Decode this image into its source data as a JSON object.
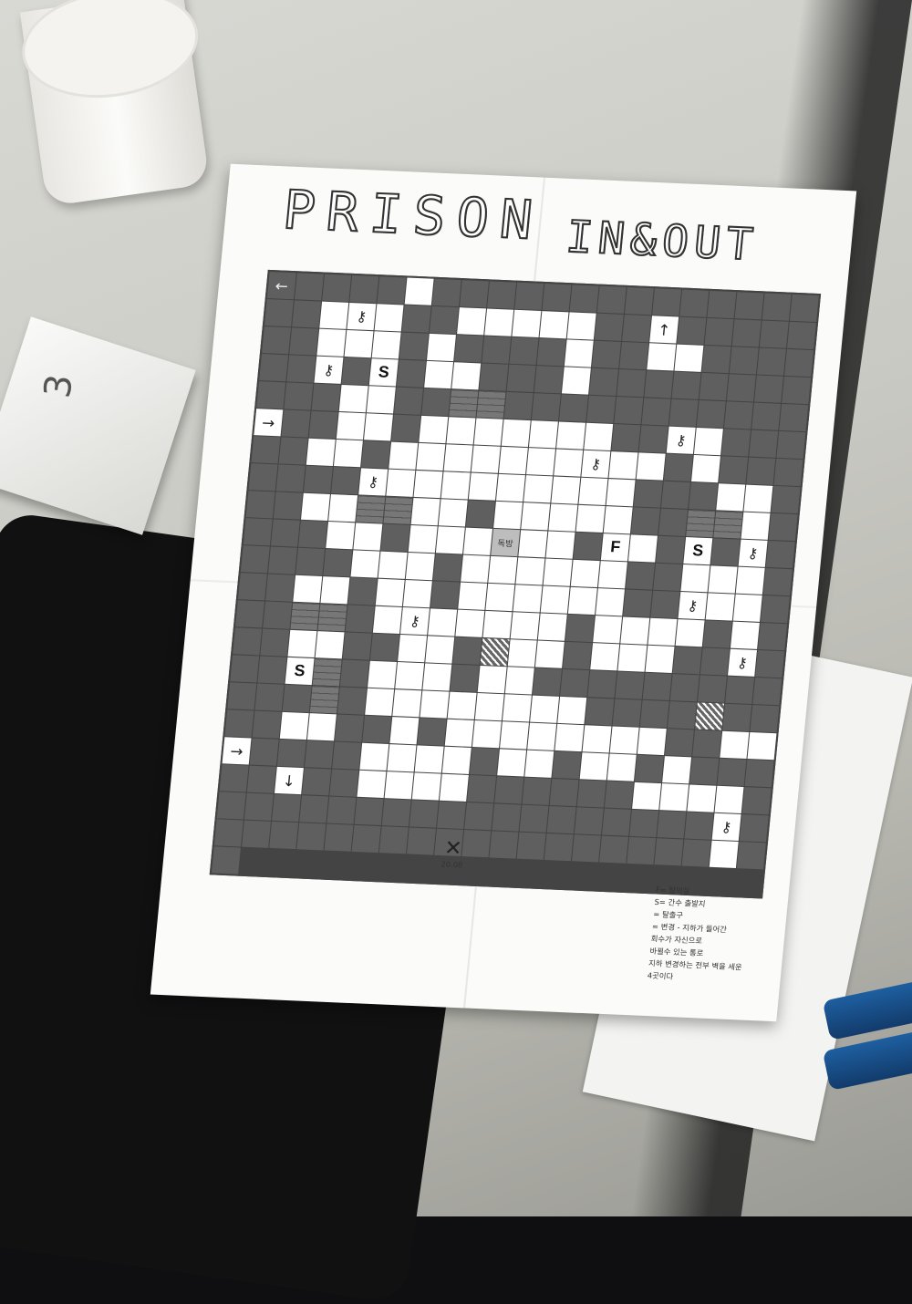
{
  "title": {
    "word1": "PRISON",
    "word2": "IN&OUT"
  },
  "board": {
    "start_label": "독방",
    "rows": [
      "<DDDDWDDDDDDDDDDDDDDD",
      "DWKWDDWWWWWDDUDDDDDD",
      "DWWWDWDDDDWDDWWDDDDD",
      "DKDSDWWDDDWDDDDDDDDD",
      "DDWWDDBBDDDDDDDDDDD>",
      "DDWWDWWWWWWWDDKWDDDD",
      "DWWDWWWWWWWKWWDWDDDD",
      "DDDKWWWWWWWWWDDDWWDD",
      "DWWBBWWDWWWWWDDBBWDD",
      "DDWWDWWWTWWDFWDSDKDD",
      "DDDWWWDWWWWWWDDWWWDD",
      "DWWDWWDWWWWWWDDKWWDD",
      "DBBDWKWWWWWDWWWWDWDD",
      "DWWDDWWDHWWDWWWDDKDD",
      "DSBDWWWDWWDDDDDDDDDD",
      "DDBDWWWWWWWWDDDDHDDD",
      "DWWDDWDWWWWWWWWDDWW>",
      "DDDDWWWWDWWDWWDWDDDD",
      "DvDDWWWWDDDDDDWWWWDD",
      "DDDDDDDDDDDDDDDDDKDD",
      "DDDDDDDDDDDDDDDDDWDD"
    ]
  },
  "legend": [
    "F= 탈의실",
    "S= 간수 출발지",
    "= 탈출구",
    "= 변경 - 지하가 들어간",
    "회수가 자신으로",
    "바뀔수 있는 통로",
    "지하 변경하는 전부 벽을 세운",
    "4곳이다"
  ],
  "signature": "20.08",
  "colors": {
    "dark_cell": "#5f5f5f",
    "light_cell": "#ffffff",
    "paper": "#fbfbfa"
  },
  "icons": {
    "key": "key-icon",
    "arrow_left": "arrow-left-icon",
    "arrow_right": "arrow-right-icon",
    "arrow_up": "arrow-up-icon",
    "arrow_down": "arrow-down-icon",
    "hole": "exit-hole-icon",
    "guard_start": "guard-start-S"
  }
}
